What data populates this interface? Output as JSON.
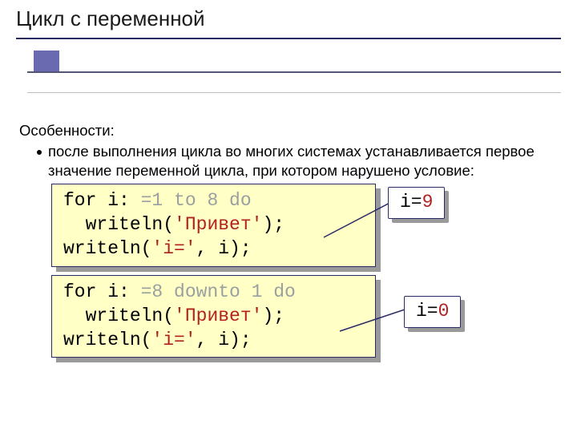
{
  "title": "Цикл с переменной",
  "features_label": "Особенности:",
  "bullet": "после выполнения цикла во многих системах устанавливается первое значение переменной цикла, при котором нарушено условие:",
  "code1": {
    "l1a": "for i:",
    "l1b": " =1 to 8 do",
    "l2a": "  writeln(",
    "l2b": "'Привет'",
    "l2c": ");",
    "l3a": "writeln(",
    "l3b": "'i='",
    "l3c": ", i);"
  },
  "badge1": {
    "prefix": "i=",
    "val": "9"
  },
  "code2": {
    "l1a": "for i:",
    "l1b": " =8 downto 1 do",
    "l2a": "  writeln(",
    "l2b": "'Привет'",
    "l2c": ");",
    "l3a": "writeln(",
    "l3b": "'i='",
    "l3c": ", i);"
  },
  "badge2": {
    "prefix": "i=",
    "val": "0"
  }
}
